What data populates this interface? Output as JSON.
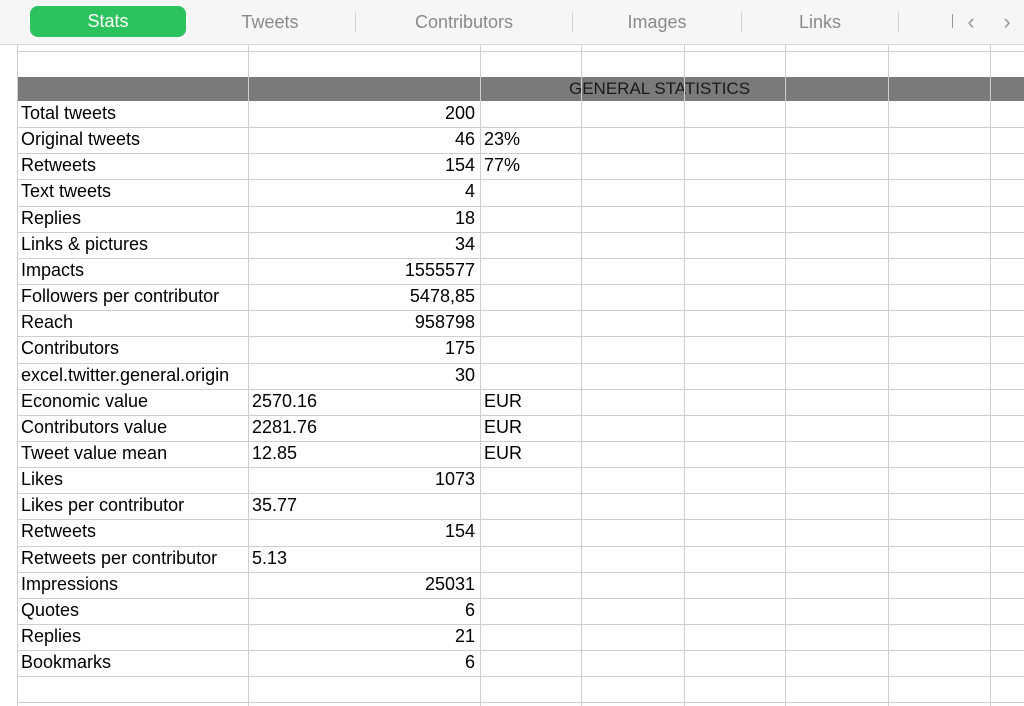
{
  "tabs": [
    {
      "label": "Stats",
      "active": true
    },
    {
      "label": "Tweets",
      "active": false
    },
    {
      "label": "Contributors",
      "active": false
    },
    {
      "label": "Images",
      "active": false
    },
    {
      "label": "Links",
      "active": false
    }
  ],
  "nav": {
    "prev_icon": "chevron-left-icon",
    "next_icon": "chevron-right-icon",
    "prev": "‹",
    "next": "›"
  },
  "colors": {
    "accent": "#2cc25e",
    "header_band": "#7a7a7a"
  },
  "section_title": "GENERAL STATISTICS",
  "rows": [
    {
      "label": "Total tweets",
      "value": "200",
      "value_align": "right",
      "extra": ""
    },
    {
      "label": "Original tweets",
      "value": "46",
      "value_align": "right",
      "extra": "23%"
    },
    {
      "label": "Retweets",
      "value": "154",
      "value_align": "right",
      "extra": "77%"
    },
    {
      "label": "Text tweets",
      "value": "4",
      "value_align": "right",
      "extra": ""
    },
    {
      "label": "Replies",
      "value": "18",
      "value_align": "right",
      "extra": ""
    },
    {
      "label": "Links & pictures",
      "value": "34",
      "value_align": "right",
      "extra": ""
    },
    {
      "label": "Impacts",
      "value": "1555577",
      "value_align": "right",
      "extra": ""
    },
    {
      "label": "Followers per contributor",
      "value": "5478,85",
      "value_align": "right",
      "extra": ""
    },
    {
      "label": "Reach",
      "value": "958798",
      "value_align": "right",
      "extra": ""
    },
    {
      "label": "Contributors",
      "value": "175",
      "value_align": "right",
      "extra": ""
    },
    {
      "label": "excel.twitter.general.origin",
      "value": "30",
      "value_align": "right",
      "extra": ""
    },
    {
      "label": "Economic value",
      "value": "2570.16",
      "value_align": "left",
      "extra": "EUR"
    },
    {
      "label": "Contributors value",
      "value": "2281.76",
      "value_align": "left",
      "extra": "EUR"
    },
    {
      "label": "Tweet value mean",
      "value": "12.85",
      "value_align": "left",
      "extra": "EUR"
    },
    {
      "label": "Likes",
      "value": "1073",
      "value_align": "right",
      "extra": ""
    },
    {
      "label": "Likes per contributor",
      "value": "35.77",
      "value_align": "left",
      "extra": ""
    },
    {
      "label": "Retweets",
      "value": "154",
      "value_align": "right",
      "extra": ""
    },
    {
      "label": "Retweets per contributor",
      "value": "5.13",
      "value_align": "left",
      "extra": ""
    },
    {
      "label": "Impressions",
      "value": "25031",
      "value_align": "right",
      "extra": ""
    },
    {
      "label": "Quotes",
      "value": "6",
      "value_align": "right",
      "extra": ""
    },
    {
      "label": "Replies",
      "value": "21",
      "value_align": "right",
      "extra": ""
    },
    {
      "label": "Bookmarks",
      "value": "6",
      "value_align": "right",
      "extra": ""
    }
  ]
}
